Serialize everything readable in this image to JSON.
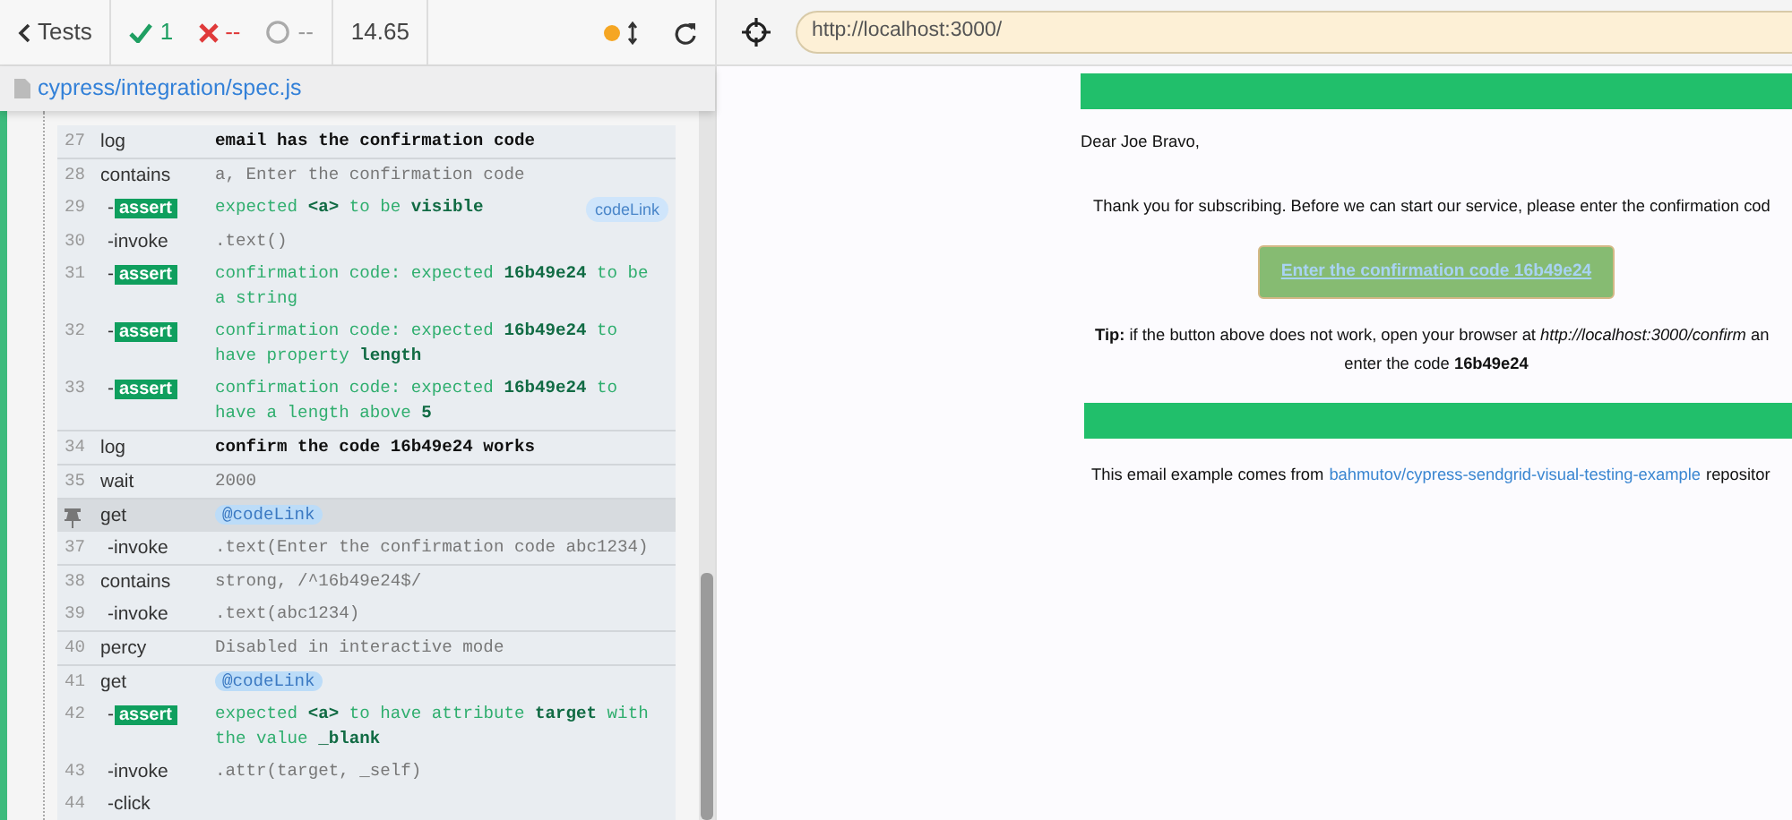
{
  "reporter": {
    "back": "Tests",
    "passed": "1",
    "failed": "--",
    "pending": "--",
    "duration": "14.65",
    "running": true
  },
  "spec": {
    "path": "cypress/integration/spec.js"
  },
  "commands": [
    {
      "number": "27",
      "name": "log",
      "kind": "log",
      "message": "email has the confirmation code",
      "divider_above": false
    },
    {
      "number": "28",
      "name": "contains",
      "kind": "cmd",
      "message": "a, Enter the confirmation code",
      "divider_above": true
    },
    {
      "number": "29",
      "dash": "-",
      "name": "assert",
      "kind": "assert",
      "message": "expected **<a>** to be **visible**",
      "alias_tag": "codeLink",
      "divider_above": false
    },
    {
      "number": "30",
      "dash": "-",
      "name": "invoke",
      "kind": "cmd",
      "message": ".text()",
      "divider_above": false
    },
    {
      "number": "31",
      "dash": "-",
      "name": "assert",
      "kind": "assert",
      "message": "confirmation code: expected **16b49e24** to be a string",
      "divider_above": false
    },
    {
      "number": "32",
      "dash": "-",
      "name": "assert",
      "kind": "assert",
      "message": "confirmation code: expected **16b49e24** to have property **length**",
      "divider_above": false
    },
    {
      "number": "33",
      "dash": "-",
      "name": "assert",
      "kind": "assert",
      "message": "confirmation code: expected **16b49e24** to have a length above **5**",
      "divider_above": false
    },
    {
      "number": "34",
      "name": "log",
      "kind": "log",
      "message": "confirm the code 16b49e24 works",
      "divider_above": true
    },
    {
      "number": "35",
      "name": "wait",
      "kind": "cmd",
      "message": "2000",
      "divider_above": true
    },
    {
      "name": "get",
      "kind": "alias",
      "message": "@codeLink",
      "pinned": true,
      "divider_above": true
    },
    {
      "number": "37",
      "dash": "-",
      "name": "invoke",
      "kind": "cmd",
      "message": ".text(Enter the confirmation code abc1234)",
      "divider_above": false
    },
    {
      "number": "38",
      "name": "contains",
      "kind": "cmd",
      "message": "strong, /^16b49e24$/",
      "divider_above": true
    },
    {
      "number": "39",
      "dash": "-",
      "name": "invoke",
      "kind": "cmd",
      "message": ".text(abc1234)",
      "divider_above": false
    },
    {
      "number": "40",
      "name": "percy",
      "kind": "cmd",
      "message": "Disabled in interactive mode",
      "divider_above": true
    },
    {
      "number": "41",
      "name": "get",
      "kind": "alias",
      "message": "@codeLink",
      "divider_above": true
    },
    {
      "number": "42",
      "dash": "-",
      "name": "assert",
      "kind": "assert",
      "message": "expected **<a>** to have attribute **target** with the value **_blank**",
      "divider_above": false
    },
    {
      "number": "43",
      "dash": "-",
      "name": "invoke",
      "kind": "cmd",
      "message": ".attr(target, _self)",
      "divider_above": false
    },
    {
      "number": "44",
      "dash": "-",
      "name": "click",
      "kind": "cmd",
      "divider_above": false
    }
  ],
  "browser": {
    "url": "http://localhost:3000/"
  },
  "email": {
    "greeting": "Dear Joe Bravo,",
    "intro": "Thank you for subscribing. Before we can start our service, please enter the confirmation cod",
    "button": "Enter the confirmation code 16b49e24",
    "tip": "**Tip:** if the button above does not work, open your browser at *http://localhost:3000/confirm* an",
    "tip_line2": "enter the code **16b49e24**",
    "footer_text": "This email example comes from",
    "footer_link": "bahmutov/cypress-sendgrid-visual-testing-example",
    "footer_end": "repositor"
  }
}
